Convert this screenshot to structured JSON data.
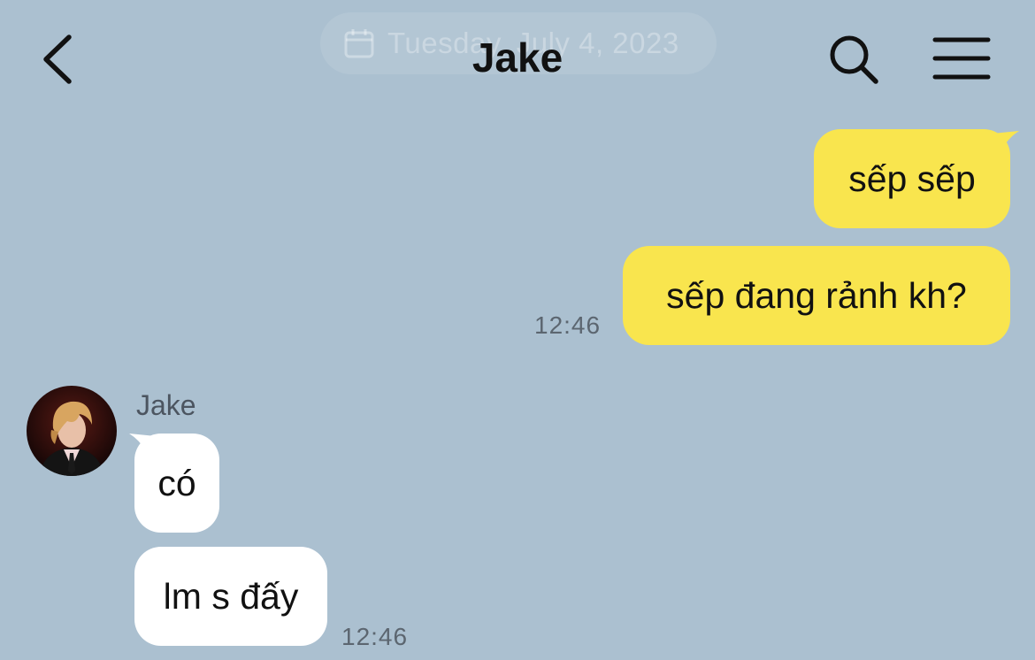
{
  "header": {
    "title": "Jake",
    "date_label": "Tuesday, July 4, 2023"
  },
  "messages": {
    "mine": [
      {
        "text": "sếp sếp"
      },
      {
        "text": "sếp đang rảnh kh?"
      }
    ],
    "mine_time": "12:46",
    "sender_name": "Jake",
    "theirs": [
      {
        "text": "có"
      },
      {
        "text": "lm s đấy"
      }
    ],
    "theirs_time": "12:46"
  },
  "colors": {
    "background": "#abc0d0",
    "my_bubble": "#f9e54e",
    "their_bubble": "#ffffff"
  },
  "icons": {
    "back": "chevron-left-icon",
    "search": "search-icon",
    "menu": "hamburger-menu-icon",
    "date": "calendar-icon"
  }
}
